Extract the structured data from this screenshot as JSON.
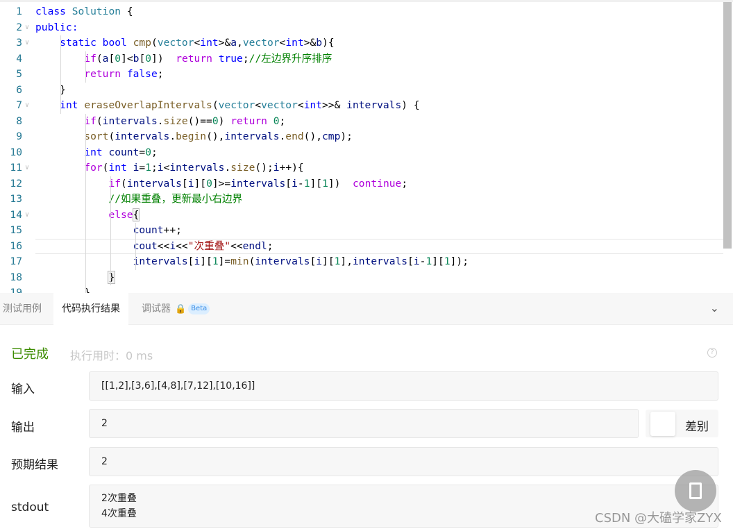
{
  "editor": {
    "current_line": 16,
    "lines": [
      [
        [
          "class",
          "kw"
        ],
        [
          " "
        ],
        [
          "Solution",
          "ty"
        ],
        [
          " {"
        ]
      ],
      [
        [
          "public:",
          "kw"
        ]
      ],
      [
        [
          "    "
        ],
        [
          "static",
          "kw"
        ],
        [
          " "
        ],
        [
          "bool",
          "kw"
        ],
        [
          " "
        ],
        [
          "cmp",
          "fn"
        ],
        [
          "("
        ],
        [
          "vector",
          "ty"
        ],
        [
          "<"
        ],
        [
          "int",
          "kw"
        ],
        [
          ">&"
        ],
        [
          "a",
          "id"
        ],
        [
          ","
        ],
        [
          "vector",
          "ty"
        ],
        [
          "<"
        ],
        [
          "int",
          "kw"
        ],
        [
          ">&"
        ],
        [
          "b",
          "id"
        ],
        [
          "){"
        ]
      ],
      [
        [
          "        "
        ],
        [
          "if",
          "ctl"
        ],
        [
          "("
        ],
        [
          "a",
          "id"
        ],
        [
          "["
        ],
        [
          "0",
          "num"
        ],
        [
          "]<"
        ],
        [
          "b",
          "id"
        ],
        [
          "["
        ],
        [
          "0",
          "num"
        ],
        [
          "])  "
        ],
        [
          "return",
          "ctl"
        ],
        [
          " "
        ],
        [
          "true",
          "kw"
        ],
        [
          ";"
        ],
        [
          "//左边界升序排序",
          "cm"
        ]
      ],
      [
        [
          "        "
        ],
        [
          "return",
          "ctl"
        ],
        [
          " "
        ],
        [
          "false",
          "kw"
        ],
        [
          ";"
        ]
      ],
      [
        [
          "    }"
        ]
      ],
      [
        [
          "    "
        ],
        [
          "int",
          "kw"
        ],
        [
          " "
        ],
        [
          "eraseOverlapIntervals",
          "fn"
        ],
        [
          "("
        ],
        [
          "vector",
          "ty"
        ],
        [
          "<"
        ],
        [
          "vector",
          "ty"
        ],
        [
          "<"
        ],
        [
          "int",
          "kw"
        ],
        [
          ">>& "
        ],
        [
          "intervals",
          "id"
        ],
        [
          ") {"
        ]
      ],
      [
        [
          "        "
        ],
        [
          "if",
          "ctl"
        ],
        [
          "("
        ],
        [
          "intervals",
          "id"
        ],
        [
          "."
        ],
        [
          "size",
          "fn"
        ],
        [
          "()=="
        ],
        [
          "0",
          "num"
        ],
        [
          ") "
        ],
        [
          "return",
          "ctl"
        ],
        [
          " "
        ],
        [
          "0",
          "num"
        ],
        [
          ";"
        ]
      ],
      [
        [
          "        "
        ],
        [
          "sort",
          "fn"
        ],
        [
          "("
        ],
        [
          "intervals",
          "id"
        ],
        [
          "."
        ],
        [
          "begin",
          "fn"
        ],
        [
          "(),"
        ],
        [
          "intervals",
          "id"
        ],
        [
          "."
        ],
        [
          "end",
          "fn"
        ],
        [
          "(),"
        ],
        [
          "cmp",
          "id"
        ],
        [
          ");"
        ]
      ],
      [
        [
          "        "
        ],
        [
          "int",
          "kw"
        ],
        [
          " "
        ],
        [
          "count",
          "id"
        ],
        [
          "="
        ],
        [
          "0",
          "num"
        ],
        [
          ";"
        ]
      ],
      [
        [
          "        "
        ],
        [
          "for",
          "ctl"
        ],
        [
          "("
        ],
        [
          "int",
          "kw"
        ],
        [
          " "
        ],
        [
          "i",
          "id"
        ],
        [
          "="
        ],
        [
          "1",
          "num"
        ],
        [
          ";"
        ],
        [
          "i",
          "id"
        ],
        [
          "<"
        ],
        [
          "intervals",
          "id"
        ],
        [
          "."
        ],
        [
          "size",
          "fn"
        ],
        [
          "();"
        ],
        [
          "i",
          "id"
        ],
        [
          "++){"
        ]
      ],
      [
        [
          "            "
        ],
        [
          "if",
          "ctl"
        ],
        [
          "("
        ],
        [
          "intervals",
          "id"
        ],
        [
          "["
        ],
        [
          "i",
          "id"
        ],
        [
          "]["
        ],
        [
          "0",
          "num"
        ],
        [
          "]>="
        ],
        [
          "intervals",
          "id"
        ],
        [
          "["
        ],
        [
          "i",
          "id"
        ],
        [
          "-"
        ],
        [
          "1",
          "num"
        ],
        [
          "]["
        ],
        [
          "1",
          "num"
        ],
        [
          "])  "
        ],
        [
          "continue",
          "ctl"
        ],
        [
          ";"
        ]
      ],
      [
        [
          "            "
        ],
        [
          "//如果重叠，更新最小右边界",
          "cm"
        ]
      ],
      [
        [
          "            "
        ],
        [
          "else",
          "ctl"
        ],
        [
          "{",
          "brk"
        ]
      ],
      [
        [
          "                "
        ],
        [
          "count",
          "id"
        ],
        [
          "++;"
        ]
      ],
      [
        [
          "                "
        ],
        [
          "cout",
          "id"
        ],
        [
          "<<"
        ],
        [
          "i",
          "id"
        ],
        [
          "<<"
        ],
        [
          "\"次重叠\"",
          "str"
        ],
        [
          "<<"
        ],
        [
          "endl",
          "id"
        ],
        [
          ";"
        ]
      ],
      [
        [
          "                "
        ],
        [
          "intervals",
          "id"
        ],
        [
          "["
        ],
        [
          "i",
          "id"
        ],
        [
          "]["
        ],
        [
          "1",
          "num"
        ],
        [
          "]="
        ],
        [
          "min",
          "fn"
        ],
        [
          "("
        ],
        [
          "intervals",
          "id"
        ],
        [
          "["
        ],
        [
          "i",
          "id"
        ],
        [
          "]["
        ],
        [
          "1",
          "num"
        ],
        [
          "],"
        ],
        [
          "intervals",
          "id"
        ],
        [
          "["
        ],
        [
          "i",
          "id"
        ],
        [
          "-"
        ],
        [
          "1",
          "num"
        ],
        [
          "]["
        ],
        [
          "1",
          "num"
        ],
        [
          "]);"
        ]
      ],
      [
        [
          "            "
        ],
        [
          "}",
          "brk"
        ]
      ],
      [
        [
          "        }"
        ]
      ]
    ],
    "folds": [
      2,
      3,
      7,
      11,
      14
    ]
  },
  "tabs": [
    {
      "label": "测试用例"
    },
    {
      "label": "代码执行结果"
    },
    {
      "label": "调试器",
      "badge": "Beta",
      "icon": "lock-icon"
    }
  ],
  "result": {
    "status": "已完成",
    "status_color": "#3c8c00",
    "runtime": "执行用时：0 ms",
    "input_label": "输入",
    "input": "[[1,2],[3,6],[4,8],[7,12],[10,16]]",
    "output_label": "输出",
    "output": "2",
    "diff_label": "差别",
    "expected_label": "预期结果",
    "expected": "2",
    "stdout_label": "stdout",
    "stdout": [
      "2次重叠",
      "4次重叠"
    ]
  },
  "watermark": "CSDN @大磕学家ZYX"
}
